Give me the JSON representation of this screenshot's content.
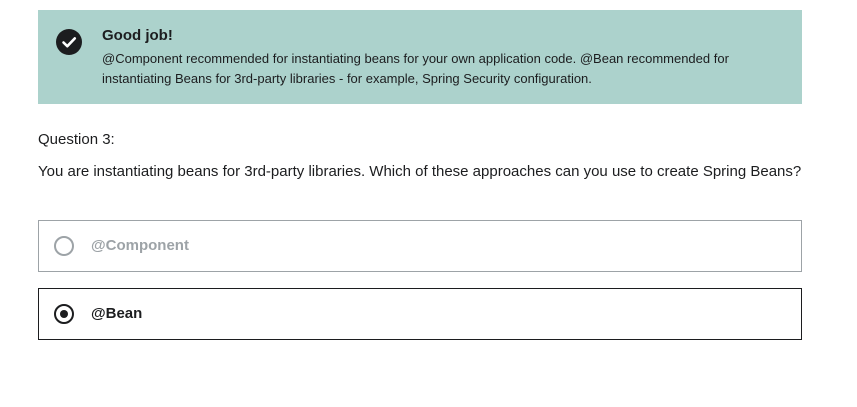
{
  "feedback": {
    "icon": "check-circle-icon",
    "title": "Good job!",
    "message": "@Component recommended for instantiating beans for your own application code. @Bean recommended for instantiating Beans for 3rd-party libraries - for example, Spring Security configuration.",
    "background_color": "#acd2cc"
  },
  "question": {
    "number_label": "Question 3:",
    "prompt": "You are instantiating beans for 3rd-party libraries. Which of these approaches can you use to create Spring Beans?",
    "options": [
      {
        "label": "@Component",
        "selected": false
      },
      {
        "label": "@Bean",
        "selected": true
      }
    ]
  }
}
